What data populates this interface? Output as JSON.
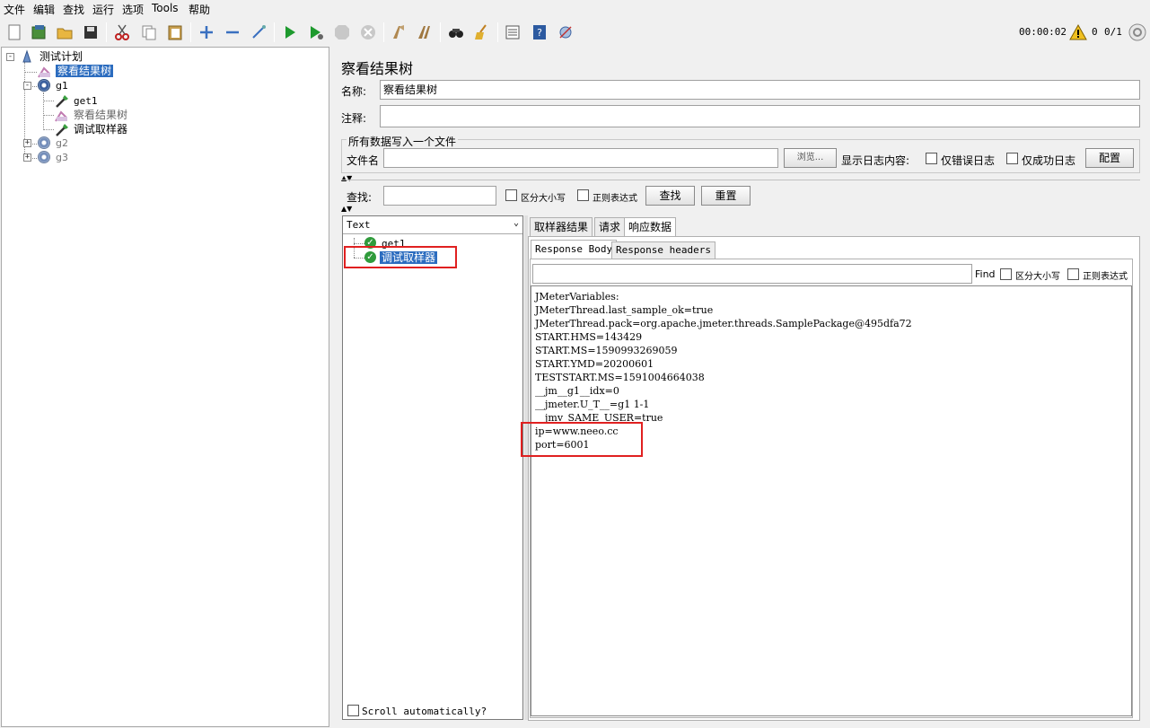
{
  "menu": [
    "文件",
    "编辑",
    "查找",
    "运行",
    "选项",
    "Tools",
    "帮助"
  ],
  "toolbar": {
    "icons": [
      "new-icon",
      "templates-icon",
      "open-icon",
      "save-icon",
      "cut-icon",
      "copy-icon",
      "paste-icon",
      "expand-icon",
      "collapse-icon",
      "toggle-icon",
      "start-icon",
      "start-no-pause-icon",
      "stop-icon",
      "shutdown-icon",
      "clear-icon",
      "clear-all-icon",
      "search-icon",
      "reset-search-icon",
      "function-helper-icon",
      "help-icon",
      "remote-icon"
    ],
    "timer": "00:00:02",
    "warning_count": "0",
    "threads": "0/1"
  },
  "tree": {
    "test_plan": "测试计划",
    "view_results_tree": "察看结果树",
    "g1": "g1",
    "get1": "get1",
    "g1_view_results_tree": "察看结果树",
    "debug_sampler": "调试取样器",
    "g2": "g2",
    "g3": "g3"
  },
  "panel": {
    "title": "察看结果树",
    "name_label": "名称:",
    "name_value": "察看结果树",
    "comment_label": "注释:",
    "comment_value": "",
    "file_group_title": "所有数据写入一个文件",
    "filename_label": "文件名",
    "filename_value": "",
    "browse_label": "浏览...",
    "log_content_label": "显示日志内容:",
    "errors_only_label": "仅错误日志",
    "success_only_label": "仅成功日志",
    "configure_label": "配置",
    "search_label": "查找:",
    "search_value": "",
    "case_sensitive_label": "区分大小写",
    "regex_label": "正则表达式",
    "search_button": "查找",
    "reset_button": "重置"
  },
  "results": {
    "renderer": "Text",
    "items": [
      "get1",
      "调试取样器"
    ],
    "scroll_auto_label": "Scroll automatically?"
  },
  "tabs": {
    "sampler_result": "取样器结果",
    "request": "请求",
    "response_data": "响应数据",
    "response_body": "Response Body",
    "response_headers": "Response headers",
    "find_label": "Find",
    "find_case_label": "区分大小写",
    "find_regex_label": "正则表达式"
  },
  "response_lines": [
    "JMeterVariables:",
    "JMeterThread.last_sample_ok=true",
    "JMeterThread.pack=org.apache.jmeter.threads.SamplePackage@495dfa72",
    "START.HMS=143429",
    "START.MS=1590993269059",
    "START.YMD=20200601",
    "TESTSTART.MS=1591004664038",
    "__jm__g1__idx=0",
    "__jmeter.U_T__=g1 1-1",
    "__jmv_SAME_USER=true",
    "ip=www.neeo.cc",
    "port=6001"
  ]
}
